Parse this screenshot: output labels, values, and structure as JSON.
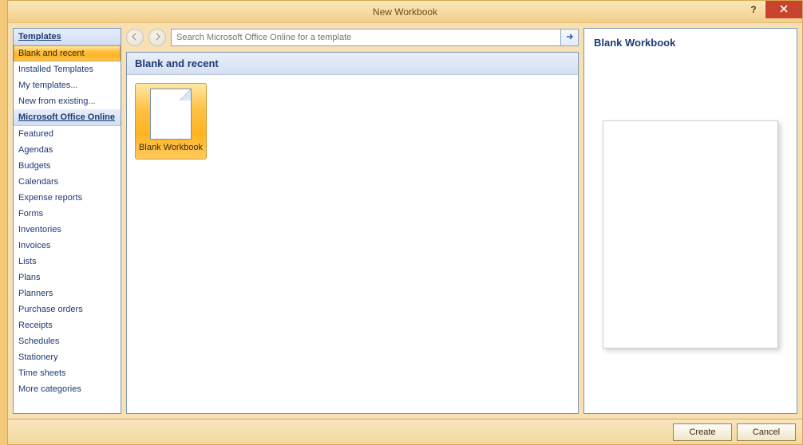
{
  "window": {
    "title": "New Workbook",
    "help_symbol": "?"
  },
  "sidebar": {
    "header1": "Templates",
    "items1": [
      "Blank and recent",
      "Installed Templates",
      "My templates...",
      "New from existing..."
    ],
    "header2": "Microsoft Office Online",
    "items2": [
      "Featured",
      "Agendas",
      "Budgets",
      "Calendars",
      "Expense reports",
      "Forms",
      "Inventories",
      "Invoices",
      "Lists",
      "Plans",
      "Planners",
      "Purchase orders",
      "Receipts",
      "Schedules",
      "Stationery",
      "Time sheets",
      "More categories"
    ],
    "selected": "Blank and recent"
  },
  "search": {
    "placeholder": "Search Microsoft Office Online for a template"
  },
  "content": {
    "header": "Blank and recent",
    "tile_label": "Blank Workbook"
  },
  "preview": {
    "title": "Blank Workbook"
  },
  "footer": {
    "create": "Create",
    "cancel": "Cancel"
  }
}
